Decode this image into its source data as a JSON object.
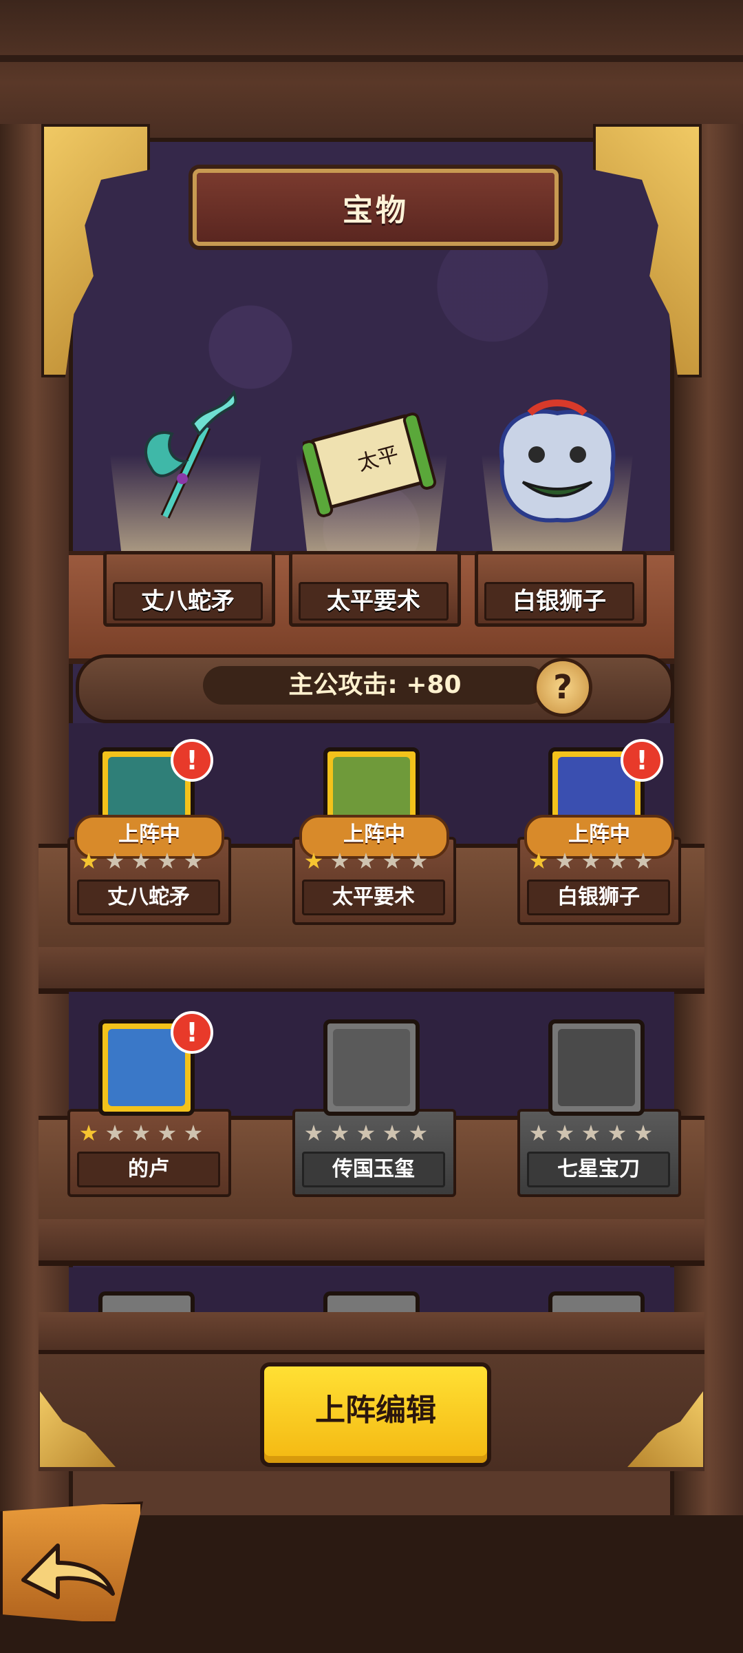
{
  "title": "宝物",
  "featured": [
    {
      "name": "丈八蛇矛",
      "icon": "serpent-spear-icon"
    },
    {
      "name": "太平要术",
      "icon": "scroll-icon"
    },
    {
      "name": "白银狮子",
      "icon": "silver-lion-icon"
    }
  ],
  "stat": {
    "text": "主公攻击: +80",
    "help": "?"
  },
  "shelf1": [
    {
      "name": "丈八蛇矛",
      "status": "上阵中",
      "stars": 1,
      "alert": "!",
      "icon": "serpent-spear-icon"
    },
    {
      "name": "太平要术",
      "status": "上阵中",
      "stars": 1,
      "icon": "scroll-icon"
    },
    {
      "name": "白银狮子",
      "status": "上阵中",
      "stars": 1,
      "alert": "!",
      "icon": "silver-lion-icon"
    }
  ],
  "shelf2": [
    {
      "name": "的卢",
      "stars": 1,
      "alert": "!",
      "icon": "horse-icon"
    },
    {
      "name": "传国玉玺",
      "stars": 0,
      "icon": "jade-seal-icon"
    },
    {
      "name": "七星宝刀",
      "stars": 0,
      "icon": "seven-star-sword-icon"
    }
  ],
  "max_stars": 5,
  "edit_button": "上阵编辑",
  "colors": {
    "accent": "#f4c21b",
    "alert": "#e83a2a",
    "back": "#35284a"
  }
}
